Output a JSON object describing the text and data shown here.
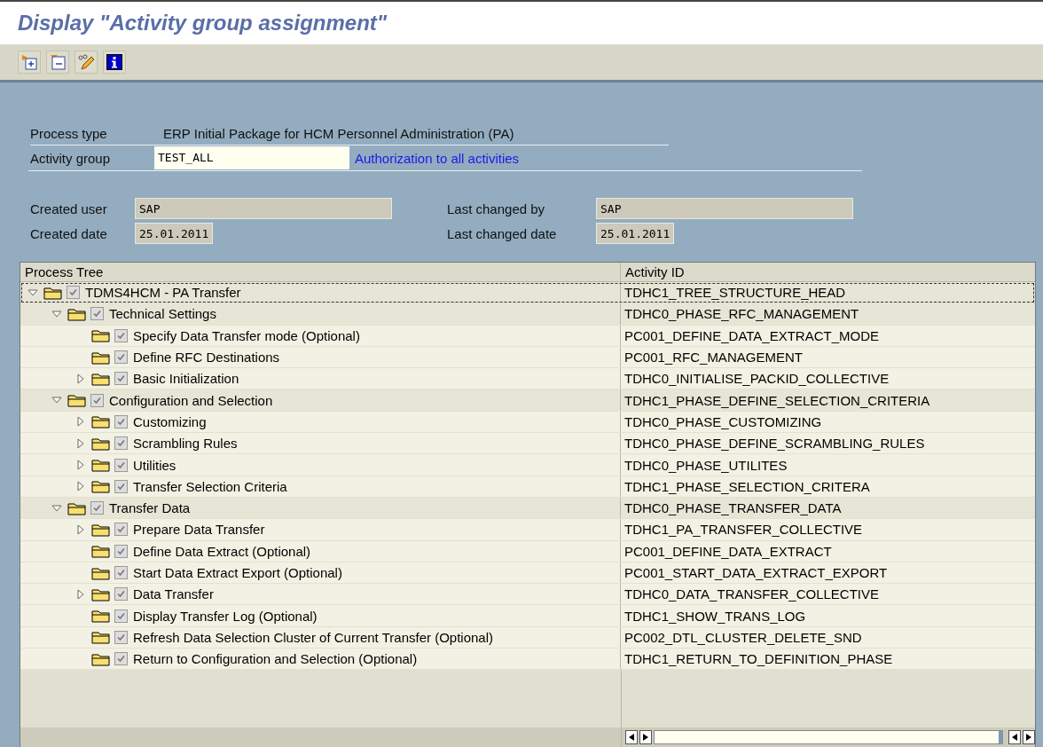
{
  "window": {
    "title": "Display  \"Activity group assignment\""
  },
  "toolbar": [
    {
      "kind": "expand"
    },
    {
      "kind": "collapse"
    },
    {
      "kind": "edit"
    },
    {
      "kind": "info"
    }
  ],
  "header": {
    "process_type": {
      "label": "Process type",
      "value": "ERP Initial Package for HCM  Personnel Administration (PA)"
    },
    "activity_group": {
      "label": "Activity group",
      "value": "TEST_ALL",
      "description": "Authorization to all activities"
    },
    "created_user": {
      "label": "Created user",
      "value": "SAP"
    },
    "created_date": {
      "label": "Created date",
      "value": "25.01.2011"
    },
    "last_changed_by": {
      "label": "Last changed by",
      "value": "SAP"
    },
    "last_changed_date": {
      "label": "Last changed date",
      "value": "25.01.2011"
    }
  },
  "tree": {
    "columns": [
      "Process Tree",
      "Activity ID"
    ],
    "items": [
      {
        "label": "TDMS4HCM - PA Transfer",
        "activity_id": "TDHC1_TREE_STRUCTURE_HEAD",
        "kind": "node",
        "expanded": true,
        "checked": true,
        "selected": true,
        "children": [
          {
            "label": "Technical Settings",
            "activity_id": "TDHC0_PHASE_RFC_MANAGEMENT",
            "kind": "node",
            "expanded": true,
            "checked": true,
            "selected": false,
            "children": [
              {
                "label": "Specify Data Transfer mode (Optional)",
                "activity_id": "PC001_DEFINE_DATA_EXTRACT_MODE",
                "kind": "leaf",
                "checked": true,
                "selected": false
              },
              {
                "label": "Define RFC Destinations",
                "activity_id": "PC001_RFC_MANAGEMENT",
                "kind": "leaf",
                "checked": true,
                "selected": false
              },
              {
                "label": "Basic Initialization",
                "activity_id": "TDHC0_INITIALISE_PACKID_COLLECTIVE",
                "kind": "node",
                "expanded": false,
                "checked": true,
                "selected": false
              }
            ]
          },
          {
            "label": "Configuration and Selection",
            "activity_id": "TDHC1_PHASE_DEFINE_SELECTION_CRITERIA",
            "kind": "node",
            "expanded": true,
            "checked": true,
            "selected": false,
            "children": [
              {
                "label": "Customizing",
                "activity_id": "TDHC0_PHASE_CUSTOMIZING",
                "kind": "node",
                "expanded": false,
                "checked": true,
                "selected": false
              },
              {
                "label": "Scrambling Rules",
                "activity_id": "TDHC0_PHASE_DEFINE_SCRAMBLING_RULES",
                "kind": "node",
                "expanded": false,
                "checked": true,
                "selected": false
              },
              {
                "label": "Utilities",
                "activity_id": "TDHC0_PHASE_UTILITES",
                "kind": "node",
                "expanded": false,
                "checked": true,
                "selected": false
              },
              {
                "label": "Transfer Selection Criteria",
                "activity_id": "TDHC1_PHASE_SELECTION_CRITERA",
                "kind": "node",
                "expanded": false,
                "checked": true,
                "selected": false
              }
            ]
          },
          {
            "label": "Transfer Data",
            "activity_id": "TDHC0_PHASE_TRANSFER_DATA",
            "kind": "node",
            "expanded": true,
            "checked": true,
            "selected": false,
            "children": [
              {
                "label": "Prepare Data Transfer",
                "activity_id": "TDHC1_PA_TRANSFER_COLLECTIVE",
                "kind": "node",
                "expanded": false,
                "checked": true,
                "selected": false
              },
              {
                "label": "Define Data Extract (Optional)",
                "activity_id": "PC001_DEFINE_DATA_EXTRACT",
                "kind": "leaf",
                "checked": true,
                "selected": false
              },
              {
                "label": "Start Data Extract Export (Optional)",
                "activity_id": "PC001_START_DATA_EXTRACT_EXPORT",
                "kind": "leaf",
                "checked": true,
                "selected": false
              },
              {
                "label": "Data Transfer",
                "activity_id": "TDHC0_DATA_TRANSFER_COLLECTIVE",
                "kind": "node",
                "expanded": false,
                "checked": true,
                "selected": false
              },
              {
                "label": "Display Transfer Log (Optional)",
                "activity_id": "TDHC1_SHOW_TRANS_LOG",
                "kind": "leaf",
                "checked": true,
                "selected": false
              },
              {
                "label": "Refresh Data Selection Cluster of Current Transfer (Optional)",
                "activity_id": "PC002_DTL_CLUSTER_DELETE_SND",
                "kind": "leaf",
                "checked": true,
                "selected": false
              },
              {
                "label": "Return to Configuration and Selection (Optional)",
                "activity_id": "TDHC1_RETURN_TO_DEFINITION_PHASE",
                "kind": "leaf",
                "checked": true,
                "selected": false
              }
            ]
          }
        ]
      }
    ]
  }
}
